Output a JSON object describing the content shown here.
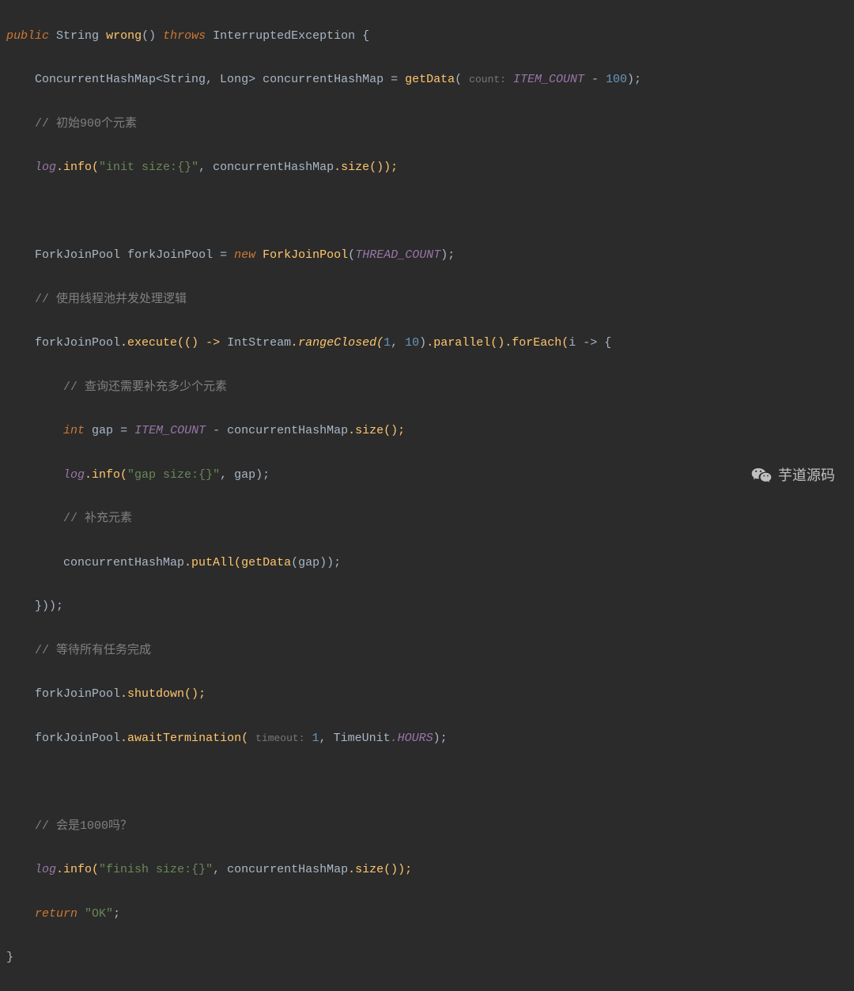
{
  "code": {
    "l1": {
      "public": "public",
      "String": "String",
      "wrong": "wrong",
      "throws": "throws",
      "Exception": "InterruptedException",
      "brace": "{"
    },
    "l2": {
      "ConcurrentHashMap": "ConcurrentHashMap",
      "generics": "<String, Long>",
      "var": "concurrentHashMap",
      "eq": " = ",
      "getData": "getData",
      "hint": "count:",
      "ITEM_COUNT": "ITEM_COUNT",
      "minus": " - ",
      "num": "100",
      "end": ");"
    },
    "l3": {
      "comment": "// 初始900个元素"
    },
    "l4": {
      "log": "log",
      "info": ".info(",
      "str": "\"init size:{}\"",
      "comma": ", ",
      "var": "concurrentHashMap",
      "size": ".size());"
    },
    "l5": {
      "blank": ""
    },
    "l6": {
      "ForkJoinPool": "ForkJoinPool",
      "var": "forkJoinPool",
      "eq": " = ",
      "new": "new",
      "ctor": "ForkJoinPool",
      "open": "(",
      "THREAD_COUNT": "THREAD_COUNT",
      "close": ");"
    },
    "l7": {
      "comment": "// 使用线程池并发处理逻辑"
    },
    "l8": {
      "var": "forkJoinPool",
      "execute": ".execute(() -> ",
      "IntStream": "IntStream",
      "rangeClosed": ".rangeClosed(",
      "a": "1",
      "comma": ", ",
      "b": "10",
      "close": ")",
      "parallel": ".parallel()",
      "forEach": ".forEach(",
      "i": "i",
      "arrow": " -> {"
    },
    "l9": {
      "comment": "// 查询还需要补充多少个元素"
    },
    "l10": {
      "int": "int",
      "gap": "gap",
      "eq": " = ",
      "ITEM_COUNT": "ITEM_COUNT",
      "minus": " - ",
      "var": "concurrentHashMap",
      "size": ".size();"
    },
    "l11": {
      "log": "log",
      "info": ".info(",
      "str": "\"gap size:{}\"",
      "comma": ", ",
      "gap": "gap",
      "close": ");"
    },
    "l12": {
      "comment": "// 补充元素"
    },
    "l13": {
      "var": "concurrentHashMap",
      "putAll": ".putAll(",
      "getData": "getData",
      "open": "(",
      "gap": "gap",
      "close": "));"
    },
    "l14": {
      "close": "}));"
    },
    "l15": {
      "comment": "// 等待所有任务完成"
    },
    "l16": {
      "var": "forkJoinPool",
      "shutdown": ".shutdown();"
    },
    "l17": {
      "var": "forkJoinPool",
      "awaitTermination": ".awaitTermination(",
      "hint": "timeout:",
      "one": "1",
      "comma": ", ",
      "TimeUnit": "TimeUnit",
      "HOURS": ".HOURS",
      "close": ");"
    },
    "l18": {
      "blank": ""
    },
    "l19": {
      "comment": "// 会是1000吗？"
    },
    "l20": {
      "log": "log",
      "info": ".info(",
      "str": "\"finish size:{}\"",
      "comma": ", ",
      "var": "concurrentHashMap",
      "size": ".size());"
    },
    "l21": {
      "return": "return",
      "ok": "\"OK\"",
      "semi": ";"
    },
    "l22": {
      "brace": "}"
    }
  },
  "watermark": {
    "text": "芋道源码"
  }
}
